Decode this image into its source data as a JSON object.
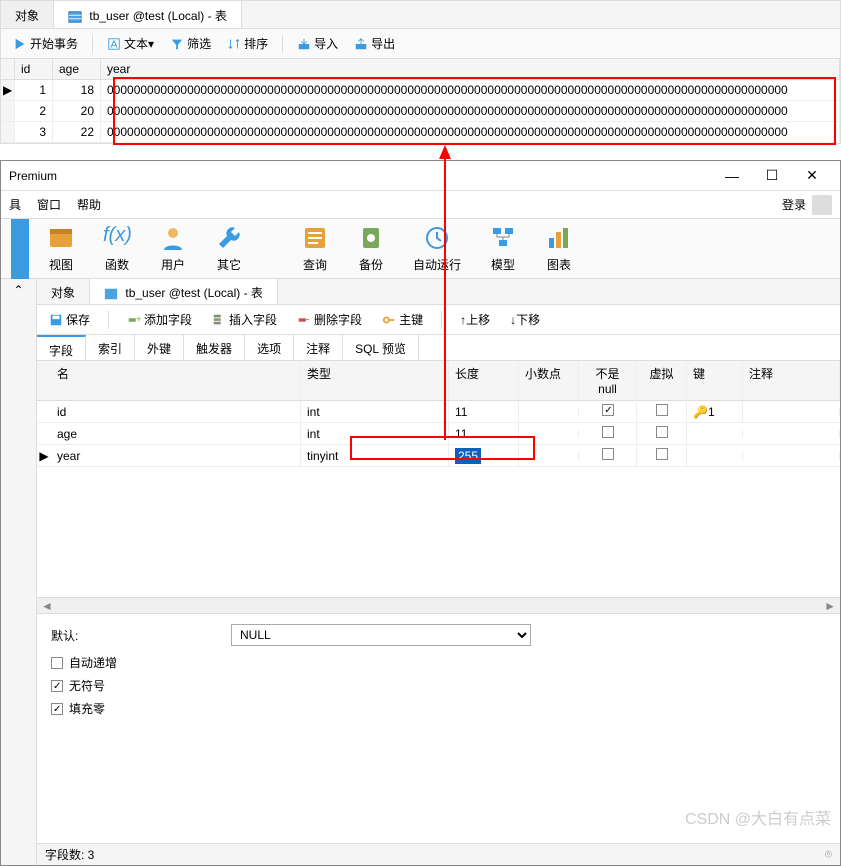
{
  "top": {
    "tabs": {
      "objects": "对象",
      "table": "tb_user @test (Local) - 表"
    },
    "toolbar": {
      "beginTx": "开始事务",
      "text": "文本",
      "filter": "筛选",
      "sort": "排序",
      "import": "导入",
      "export": "导出"
    },
    "grid": {
      "headers": {
        "id": "id",
        "age": "age",
        "year": "year"
      },
      "rows": [
        {
          "id": "1",
          "age": "18",
          "year": "000000000000000000000000000000000000000000000000000000000000000000000000000000000000000000000000000000"
        },
        {
          "id": "2",
          "age": "20",
          "year": "000000000000000000000000000000000000000000000000000000000000000000000000000000000000000000000000000000"
        },
        {
          "id": "3",
          "age": "22",
          "year": "000000000000000000000000000000000000000000000000000000000000000000000000000000000000000000000000000000"
        }
      ]
    }
  },
  "bottom": {
    "title": "Premium",
    "menu": {
      "tools": "具",
      "window": "窗口",
      "help": "帮助",
      "login": "登录"
    },
    "bigbar": {
      "view": "视图",
      "func": "函数",
      "user": "用户",
      "other": "其它",
      "query": "查询",
      "backup": "备份",
      "auto": "自动运行",
      "model": "模型",
      "chart": "图表"
    },
    "designTabs": {
      "objects": "对象",
      "table": "tb_user @test (Local) - 表"
    },
    "dtoolbar": {
      "save": "保存",
      "addField": "添加字段",
      "insertField": "插入字段",
      "deleteField": "删除字段",
      "primaryKey": "主键",
      "moveUp": "上移",
      "moveDown": "下移"
    },
    "subtabs": {
      "fields": "字段",
      "indexes": "索引",
      "fks": "外键",
      "triggers": "触发器",
      "options": "选项",
      "comment": "注释",
      "sqlPreview": "SQL 预览"
    },
    "ftable": {
      "headers": {
        "name": "名",
        "type": "类型",
        "len": "长度",
        "dec": "小数点",
        "nn": "不是 null",
        "virt": "虚拟",
        "key": "键",
        "note": "注释"
      },
      "rows": [
        {
          "name": "id",
          "type": "int",
          "len": "11",
          "dec": "",
          "nn": true,
          "virt": false,
          "key": "1"
        },
        {
          "name": "age",
          "type": "int",
          "len": "11",
          "dec": "",
          "nn": false,
          "virt": false,
          "key": ""
        },
        {
          "name": "year",
          "type": "tinyint",
          "len": "255",
          "dec": "",
          "nn": false,
          "virt": false,
          "key": ""
        }
      ]
    },
    "props": {
      "defaultLabel": "默认:",
      "defaultValue": "NULL",
      "autoInc": "自动递增",
      "unsigned": "无符号",
      "zerofill": "填充零",
      "autoIncChecked": false,
      "unsignedChecked": true,
      "zerofillChecked": true
    },
    "status": {
      "fieldCount": "字段数: 3"
    }
  },
  "watermark": "CSDN @大白有点菜"
}
